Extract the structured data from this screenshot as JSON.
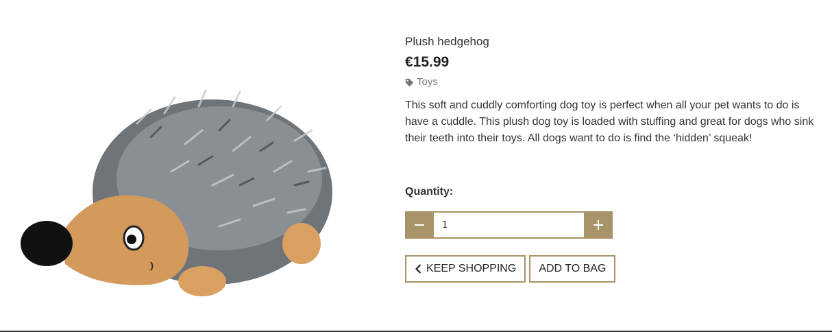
{
  "product": {
    "image_alt": "Plush hedgehog",
    "name": "Plush hedgehog",
    "price": "€15.99",
    "category": "Toys",
    "category_icon": "tag-icon",
    "description": "This soft and cuddly comforting dog toy is perfect when all your pet wants to do is have a cuddle. This plush dog toy is loaded with stuffing and great for dogs who sink their teeth into their toys. All dogs want to do is find the ‘hidden’ squeak!"
  },
  "quantity": {
    "label": "Quantity:",
    "value": "1",
    "decrement_icon": "minus-icon",
    "increment_icon": "plus-icon"
  },
  "actions": {
    "keep_shopping": "KEEP SHOPPING",
    "keep_shopping_icon": "chevron-left-icon",
    "add_to_bag": "ADD TO BAG"
  },
  "colors": {
    "accent": "#a89468",
    "text": "#333333",
    "muted": "#777777"
  }
}
